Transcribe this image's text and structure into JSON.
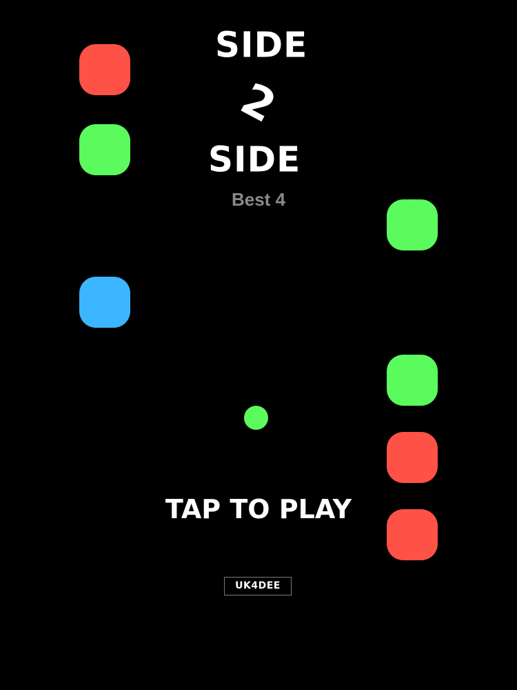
{
  "game": {
    "title_line_1": "SIDE",
    "title_line_2": "2",
    "title_line_3": "SIDE",
    "best_label": "Best",
    "best_score": "4",
    "tap_to_play": "TAP TO PLAY",
    "brand": "UK4DEE"
  },
  "colors": {
    "background": "#000000",
    "red": "#fd5245",
    "green": "#5bfa5d",
    "blue": "#3bb6ff",
    "ball": "#5bfa5d"
  },
  "tiles": {
    "left": [
      "red",
      "green",
      "blue"
    ],
    "right": [
      "green",
      "green",
      "red",
      "red"
    ]
  },
  "ball_color": "green"
}
